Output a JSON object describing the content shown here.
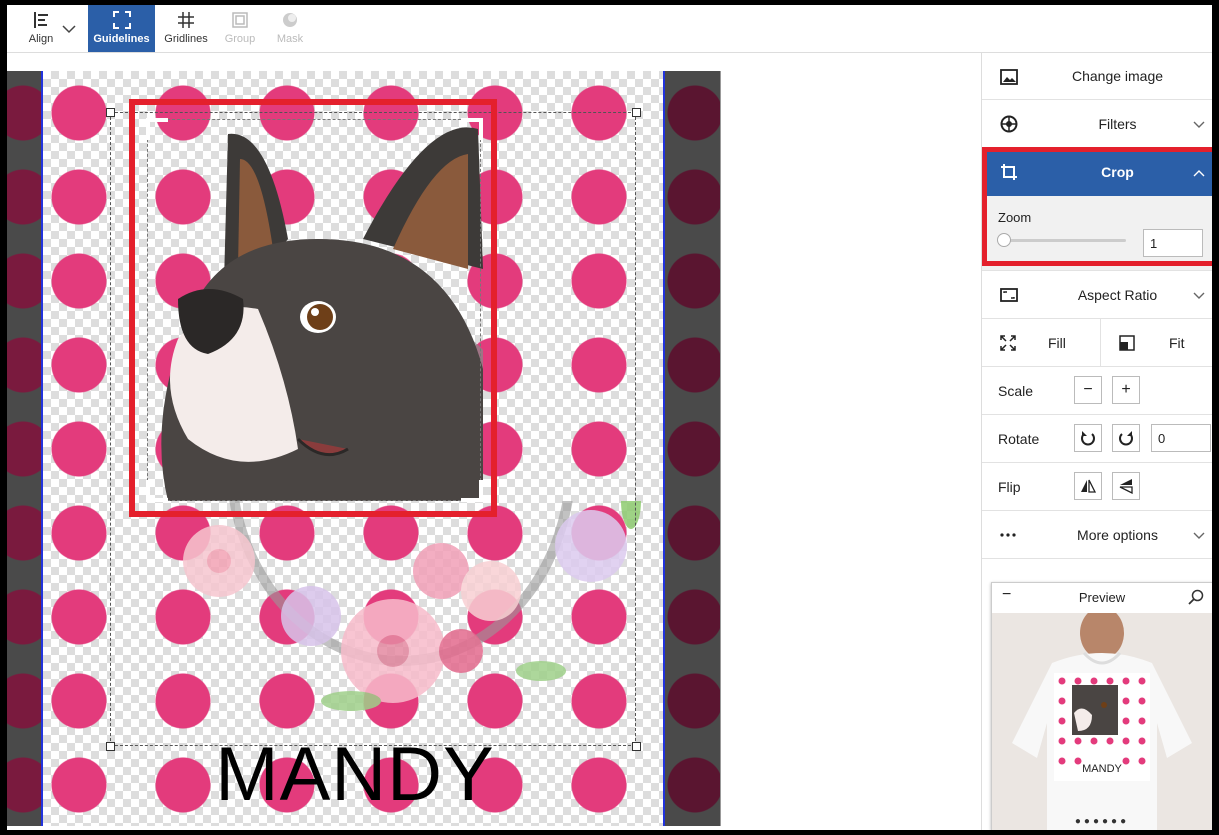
{
  "toolbar": {
    "align_label": "Align",
    "guidelines_label": "Guidelines",
    "gridlines_label": "Gridlines",
    "group_label": "Group",
    "mask_label": "Mask"
  },
  "canvas": {
    "design_text": "MANDY"
  },
  "panel": {
    "change_image_label": "Change image",
    "filters_label": "Filters",
    "crop_label": "Crop",
    "zoom_label": "Zoom",
    "zoom_value": "1",
    "aspect_ratio_label": "Aspect Ratio",
    "fill_label": "Fill",
    "fit_label": "Fit",
    "scale_label": "Scale",
    "scale_minus": "−",
    "scale_plus": "+",
    "rotate_label": "Rotate",
    "rotate_value": "0",
    "flip_label": "Flip",
    "more_options_label": "More options"
  },
  "preview": {
    "title": "Preview",
    "minimize": "−",
    "shirt_text": "MANDY",
    "pager": "●●●●●●"
  },
  "colors": {
    "accent": "#2b5fa8",
    "highlight": "#e4202c",
    "polka_dot": "#e33b7c"
  }
}
